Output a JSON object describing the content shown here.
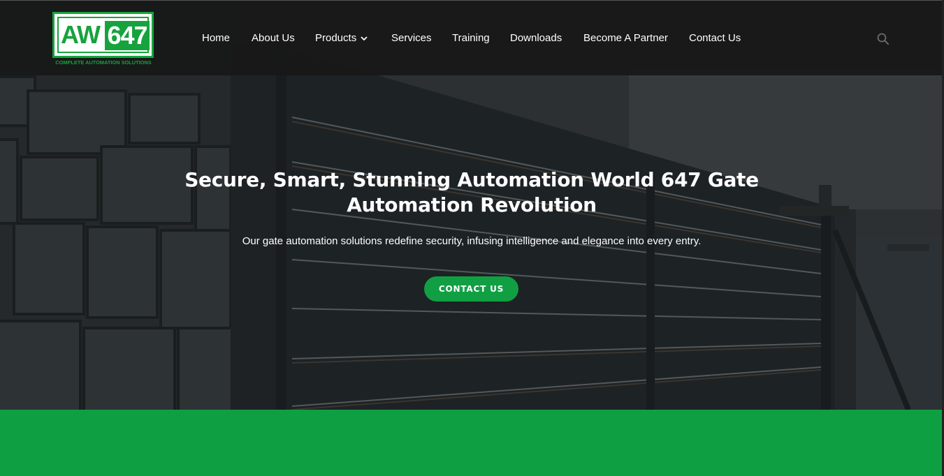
{
  "brand": {
    "letters": "AW",
    "number": "647",
    "tagline": "COMPLETE AUTOMATION SOLUTIONS",
    "color": "#16a33d"
  },
  "nav": {
    "items": [
      {
        "label": "Home"
      },
      {
        "label": "About Us"
      },
      {
        "label": "Products",
        "has_dropdown": true
      },
      {
        "label": "Services"
      },
      {
        "label": "Training"
      },
      {
        "label": "Downloads"
      },
      {
        "label": "Become A Partner"
      },
      {
        "label": "Contact Us"
      }
    ],
    "search_icon": "search-icon",
    "dropdown_icon": "chevron-down-icon"
  },
  "hero": {
    "title_line1": "Secure, Smart, Stunning Automation World 647 Gate",
    "title_line2": "Automation Revolution",
    "subtitle": "Our gate automation solutions redefine security, infusing intelligence and elegance into every entry.",
    "cta_label": "CONTACT US",
    "cta_color": "#10a043"
  },
  "colors": {
    "header_bg": "#181818",
    "band": "#0f9f43"
  }
}
